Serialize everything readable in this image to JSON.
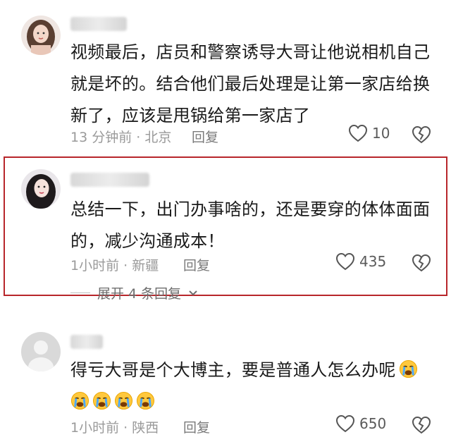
{
  "comments": [
    {
      "username": "",
      "text": "视频最后，店员和警察诱导大哥让他说相机自己就是坏的。结合他们最后处理是让第一家店给换新了，应该是甩锅给第一家店了",
      "time": "13 分钟前",
      "location": "北京",
      "reply_label": "回复",
      "likes": "10"
    },
    {
      "username": "",
      "text": "总结一下，出门办事啥的，还是要穿的体体面面的，减少沟通成本！",
      "time": "1小时前",
      "location": "新疆",
      "reply_label": "回复",
      "likes": "435",
      "expand_label": "展开 4 条回复"
    },
    {
      "username": "",
      "text": "得亏大哥是个大博主，要是普通人怎么办呢",
      "time": "1小时前",
      "location": "陕西",
      "reply_label": "回复",
      "likes": "650",
      "emojis": [
        "crying-face",
        "crying-face",
        "crying-face",
        "crying-face",
        "crying-face"
      ]
    }
  ],
  "separator": "·",
  "colors": {
    "highlight_border": "#b8262b",
    "meta_text": "#9a9a9a"
  },
  "icons": {
    "like": "heart-outline-icon",
    "dislike": "broken-heart-icon"
  }
}
